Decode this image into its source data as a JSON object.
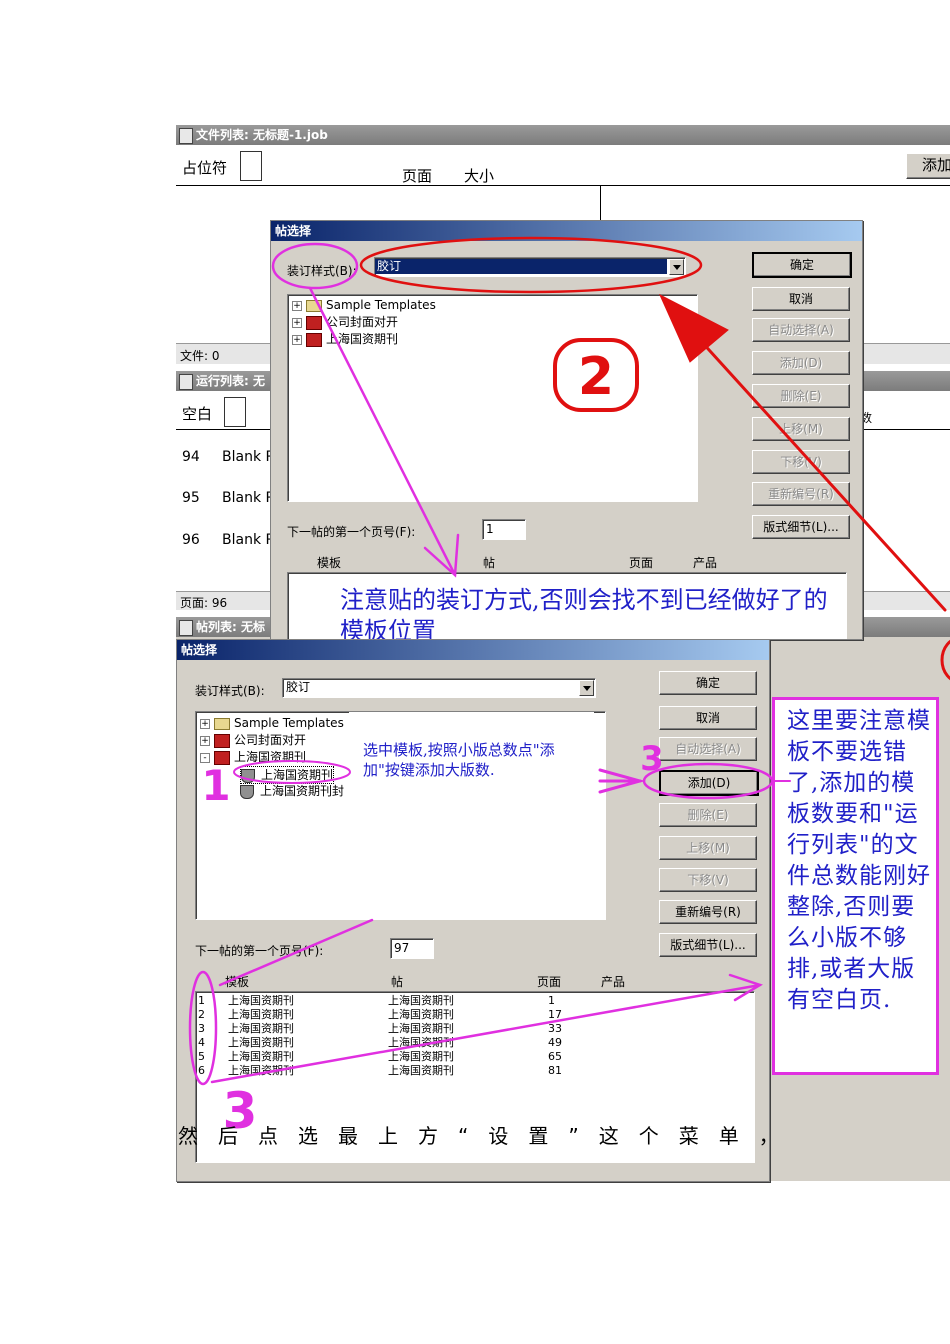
{
  "file_list_window": {
    "title": "文件列表: 无标题-1.job",
    "placeholder_label": "占位符",
    "col_page": "页面",
    "col_size": "大小",
    "add_button": "添加",
    "status": "文件: 0"
  },
  "run_list_window": {
    "title": "运行列表: 无",
    "blank_label": "空白",
    "col_partial": "数",
    "rows": [
      {
        "num": "94",
        "name": "Blank P"
      },
      {
        "num": "95",
        "name": "Blank P"
      },
      {
        "num": "96",
        "name": "Blank P"
      }
    ],
    "status": "页面: 96"
  },
  "signature_list_window": {
    "title": "帖列表: 无标"
  },
  "dialog_top": {
    "title": "帖选择",
    "binding_label": "装订样式(B):",
    "binding_value": "胶订",
    "tree": [
      {
        "pm": "+",
        "icon": "folder",
        "label": "Sample Templates"
      },
      {
        "pm": "+",
        "icon": "template",
        "label": "公司封面对开"
      },
      {
        "pm": "+",
        "icon": "template",
        "label": "上海国资期刊"
      }
    ],
    "next_first_page_label": "下一帖的第一个页号(F):",
    "next_first_page_value": "1",
    "columns": [
      "模板",
      "帖",
      "页面",
      "产品"
    ],
    "buttons": {
      "ok": "确定",
      "cancel": "取消",
      "auto_select": "自动选择(A)",
      "add": "添加(D)",
      "delete": "删除(E)",
      "move_up": "上移(M)",
      "move_down": "下移(V)",
      "renumber": "重新编号(R)",
      "layout_detail": "版式细节(L)..."
    },
    "annotation": "注意贴的装订方式,否则会找不到已经做好了的模板位置"
  },
  "dialog_bottom": {
    "title": "帖选择",
    "binding_label": "装订样式(B):",
    "binding_value": "胶订",
    "tree": [
      {
        "pm": "+",
        "icon": "folder",
        "label": "Sample Templates"
      },
      {
        "pm": "+",
        "icon": "template",
        "label": "公司封面对开"
      },
      {
        "pm": "-",
        "icon": "template",
        "label": "上海国资期刊"
      },
      {
        "pm": "",
        "icon": "shield",
        "label": "上海国资期刊"
      },
      {
        "pm": "",
        "icon": "shield",
        "label": "上海国资期刊封"
      }
    ],
    "next_first_page_label": "下一帖的第一个页号(F):",
    "next_first_page_value": "97",
    "columns": [
      "模板",
      "帖",
      "页面",
      "产品"
    ],
    "rows": [
      {
        "n": "1",
        "template": "上海国资期刊",
        "signature": "上海国资期刊",
        "page": "1"
      },
      {
        "n": "2",
        "template": "上海国资期刊",
        "signature": "上海国资期刊",
        "page": "17"
      },
      {
        "n": "3",
        "template": "上海国资期刊",
        "signature": "上海国资期刊",
        "page": "33"
      },
      {
        "n": "4",
        "template": "上海国资期刊",
        "signature": "上海国资期刊",
        "page": "49"
      },
      {
        "n": "5",
        "template": "上海国资期刊",
        "signature": "上海国资期刊",
        "page": "65"
      },
      {
        "n": "6",
        "template": "上海国资期刊",
        "signature": "上海国资期刊",
        "page": "81"
      }
    ],
    "buttons": {
      "ok": "确定",
      "cancel": "取消",
      "auto_select": "自动选择(A)",
      "add": "添加(D)",
      "delete": "删除(E)",
      "move_up": "上移(M)",
      "move_down": "下移(V)",
      "renumber": "重新编号(R)",
      "layout_detail": "版式细节(L)..."
    },
    "annotation": "选中模板,按照小版总数点\"添加\"按键添加大版数."
  },
  "side_note": "这里要注意模板不要选错了,添加的模板数要和\"运行列表\"的文件总数能刚好整除,否则要么小版不够排,或者大版有空白页.",
  "step_marks": {
    "one": "1",
    "two": "2",
    "three_small": "3",
    "three_big": "3"
  },
  "caption": "然后点选最上方“设置”这个菜单，",
  "colors": {
    "annotation_magenta": "#e030e0",
    "annotation_red": "#e01010",
    "handwriting_blue": "#2020c8"
  }
}
